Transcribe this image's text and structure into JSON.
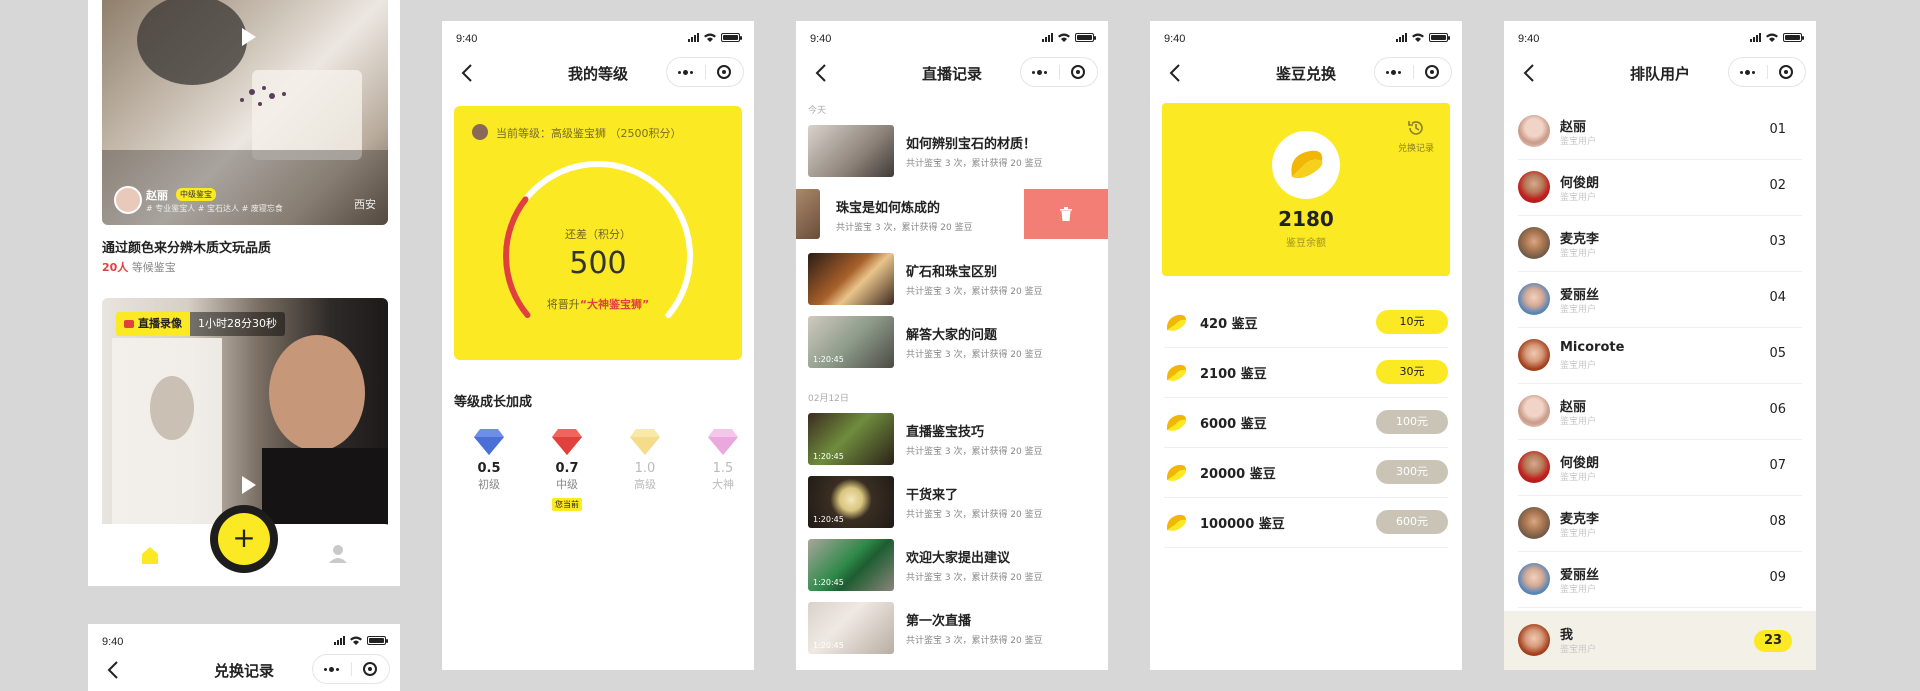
{
  "colors": {
    "brand_yellow": "#fbe923",
    "delete_red": "#f37e75",
    "accent_red": "#e0413c",
    "muted_gray": "#c9c4b6"
  },
  "status": {
    "time": "9:40"
  },
  "screen1": {
    "card1": {
      "user": "赵丽",
      "badge": "中级鉴宝",
      "tags": "# 专业鉴宝人  # 宝石达人  # 废寝忘食",
      "city": "西安",
      "title": "通过颜色来分辨木质文玩品质",
      "count": "20人",
      "count_suffix": "等候鉴宝"
    },
    "card2": {
      "live_tag": "直播录像",
      "duration": "1小时28分30秒"
    },
    "fab_label": "+"
  },
  "screen1b": {
    "title": "兑换记录"
  },
  "screen2": {
    "title": "我的等级",
    "current_level": "当前等级：高级鉴宝狮 （2500积分）",
    "remain_label": "还差（积分）",
    "remain_value": "500",
    "promote_prefix": "将晋升",
    "promote_target": "“大神鉴宝狮”",
    "progress": 0.3,
    "growth_title": "等级成长加成",
    "levels": [
      {
        "value": "0.5",
        "name": "初级"
      },
      {
        "value": "0.7",
        "name": "中级"
      },
      {
        "value": "1.0",
        "name": "高级"
      },
      {
        "value": "1.5",
        "name": "大神"
      }
    ],
    "current_badge": "您当前"
  },
  "screen3": {
    "title": "直播记录",
    "section_today": "今天",
    "section_date": "02月12日",
    "delete_icon": "trash-icon",
    "items": [
      {
        "title": "如何辨别宝石的材质！",
        "sub": "共计鉴宝 3 次，累计获得 20 鉴豆",
        "duration": ""
      },
      {
        "title": "珠宝是如何炼成的",
        "sub": "共计鉴宝 3 次，累计获得 20 鉴豆",
        "duration": ""
      },
      {
        "title": "矿石和珠宝区别",
        "sub": "共计鉴宝 3 次，累计获得 20 鉴豆",
        "duration": ""
      },
      {
        "title": "解答大家的问题",
        "sub": "共计鉴宝 3 次，累计获得 20 鉴豆",
        "duration": "1:20:45"
      },
      {
        "title": "直播鉴宝技巧",
        "sub": "共计鉴宝 3 次，累计获得 20 鉴豆",
        "duration": "1:20:45"
      },
      {
        "title": "干货来了",
        "sub": "共计鉴宝 3 次，累计获得 20 鉴豆",
        "duration": "1:20:45"
      },
      {
        "title": "欢迎大家提出建议",
        "sub": "共计鉴宝 3 次，累计获得 20 鉴豆",
        "duration": "1:20:45"
      },
      {
        "title": "第一次直播",
        "sub": "共计鉴宝 3 次，累计获得 20 鉴豆",
        "duration": "1:20:45"
      }
    ]
  },
  "screen4": {
    "title": "鉴豆兑换",
    "history_label": "兑换记录",
    "balance": "2180",
    "balance_label": "鉴豆余额",
    "options": [
      {
        "label": "420 鉴豆",
        "price": "10元"
      },
      {
        "label": "2100 鉴豆",
        "price": "30元"
      },
      {
        "label": "6000 鉴豆",
        "price": "100元"
      },
      {
        "label": "20000 鉴豆",
        "price": "300元"
      },
      {
        "label": "100000 鉴豆",
        "price": "600元"
      }
    ]
  },
  "screen5": {
    "title": "排队用户",
    "users": [
      {
        "name": "赵丽",
        "role": "鉴宝用户",
        "num": "01"
      },
      {
        "name": "何俊朗",
        "role": "鉴宝用户",
        "num": "02"
      },
      {
        "name": "麦克李",
        "role": "鉴宝用户",
        "num": "03"
      },
      {
        "name": "爱丽丝",
        "role": "鉴宝用户",
        "num": "04"
      },
      {
        "name": "Micorote",
        "role": "鉴宝用户",
        "num": "05"
      },
      {
        "name": "赵丽",
        "role": "鉴宝用户",
        "num": "06"
      },
      {
        "name": "何俊朗",
        "role": "鉴宝用户",
        "num": "07"
      },
      {
        "name": "麦克李",
        "role": "鉴宝用户",
        "num": "08"
      },
      {
        "name": "爱丽丝",
        "role": "鉴宝用户",
        "num": "09"
      }
    ],
    "me": {
      "name": "我",
      "role": "鉴宝用户",
      "num": "23"
    }
  }
}
